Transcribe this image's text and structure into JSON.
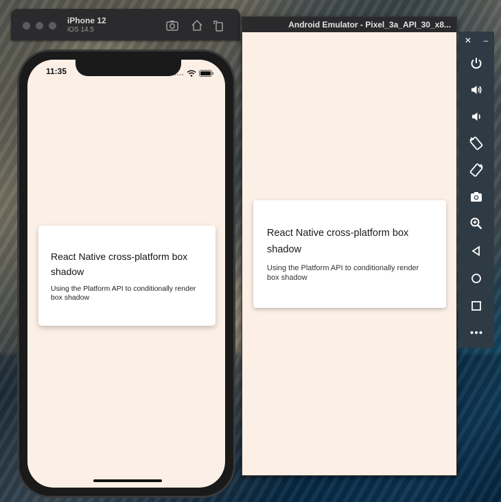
{
  "ios_simulator": {
    "device_name": "iPhone 12",
    "os_version": "iOS 14.5",
    "toolbar_icons": [
      "screenshot-icon",
      "home-icon",
      "rotate-icon"
    ],
    "status_bar": {
      "time": "11:35",
      "icons": [
        "signal-dots-icon",
        "wifi-icon",
        "battery-icon"
      ]
    },
    "card": {
      "title": "React Native cross-platform box shadow",
      "body": "Using the Platform API to conditionally render box shadow"
    }
  },
  "android_emulator": {
    "window_title": "Android Emulator - Pixel_3a_API_30_x8...",
    "card": {
      "title": "React Native cross-platform box shadow",
      "body": "Using the Platform API to conditionally render box shadow"
    }
  },
  "emulator_controls": {
    "window_buttons": [
      "close-icon",
      "minimize-icon"
    ],
    "buttons": [
      "power-icon",
      "volume-up-icon",
      "volume-down-icon",
      "rotate-left-icon",
      "rotate-right-icon",
      "camera-icon",
      "zoom-icon",
      "back-icon",
      "home-icon",
      "overview-icon",
      "more-icon"
    ]
  },
  "colors": {
    "app_background": "#fcf0e6",
    "card_background": "#ffffff",
    "emulator_toolbar": "#2e3b44"
  }
}
